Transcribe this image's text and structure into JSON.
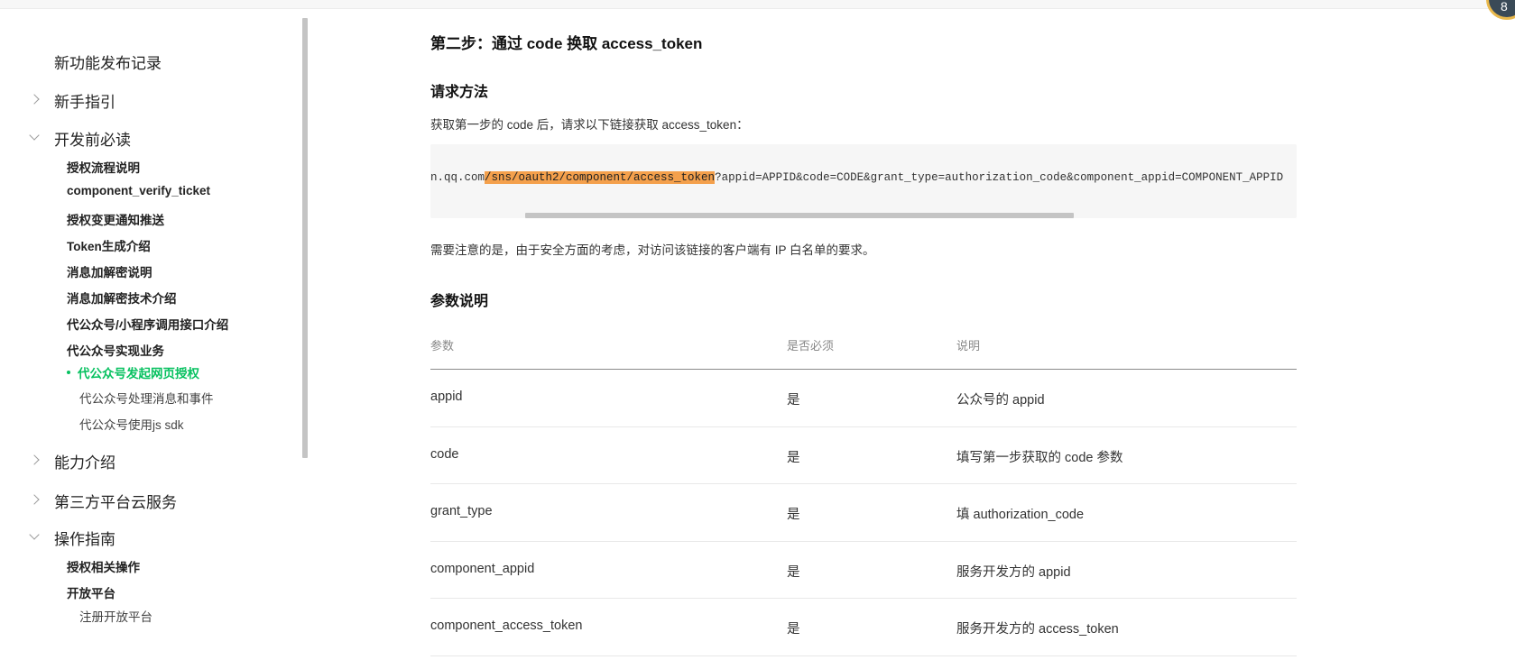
{
  "sidebar": {
    "items": [
      {
        "label": "新功能发布记录",
        "level": 1,
        "arrow": "none"
      },
      {
        "label": "新手指引",
        "level": 1,
        "arrow": "right"
      },
      {
        "label": "开发前必读",
        "level": 1,
        "arrow": "down"
      },
      {
        "label": "授权流程说明",
        "level": 2
      },
      {
        "label": "component_verify_ticket",
        "level": 2
      },
      {
        "label": "授权变更通知推送",
        "level": 2
      },
      {
        "label": "Token生成介绍",
        "level": 2
      },
      {
        "label": "消息加解密说明",
        "level": 2
      },
      {
        "label": "消息加解密技术介绍",
        "level": 2
      },
      {
        "label": "代公众号/小程序调用接口介绍",
        "level": 2
      },
      {
        "label": "代公众号实现业务",
        "level": 2
      },
      {
        "label": "代公众号发起网页授权",
        "level": 2,
        "active": true
      },
      {
        "label": "代公众号处理消息和事件",
        "level": 3
      },
      {
        "label": "代公众号使用js sdk",
        "level": 3
      },
      {
        "label": "能力介绍",
        "level": 1,
        "arrow": "right"
      },
      {
        "label": "第三方平台云服务",
        "level": 1,
        "arrow": "right"
      },
      {
        "label": "操作指南",
        "level": 1,
        "arrow": "down"
      },
      {
        "label": "授权相关操作",
        "level": 2
      },
      {
        "label": "开放平台",
        "level": 2
      },
      {
        "label": "注册开放平台",
        "level": 3
      }
    ],
    "active_color": "#07c160"
  },
  "corner_avatar_glyph": "8",
  "content": {
    "step_title": "第二步：通过 code 换取 access_token",
    "request_heading": "请求方法",
    "request_desc": "获取第一步的 code 后，请求以下链接获取 access_token：",
    "code": {
      "prefix": "n.qq.com",
      "highlight": "/sns/oauth2/component/access_token",
      "suffix": "?appid=APPID&code=CODE&grant_type=authorization_code&component_appid=COMPONENT_APPID",
      "highlight_color": "#f4a04c"
    },
    "note": "需要注意的是，由于安全方面的考虑，对访问该链接的客户端有 IP 白名单的要求。",
    "params_heading": "参数说明",
    "table": {
      "headers": [
        "参数",
        "是否必须",
        "说明"
      ],
      "rows": [
        [
          "appid",
          "是",
          "公众号的 appid"
        ],
        [
          "code",
          "是",
          "填写第一步获取的 code 参数"
        ],
        [
          "grant_type",
          "是",
          "填 authorization_code"
        ],
        [
          "component_appid",
          "是",
          "服务开发方的 appid"
        ],
        [
          "component_access_token",
          "是",
          "服务开发方的 access_token"
        ]
      ]
    }
  }
}
